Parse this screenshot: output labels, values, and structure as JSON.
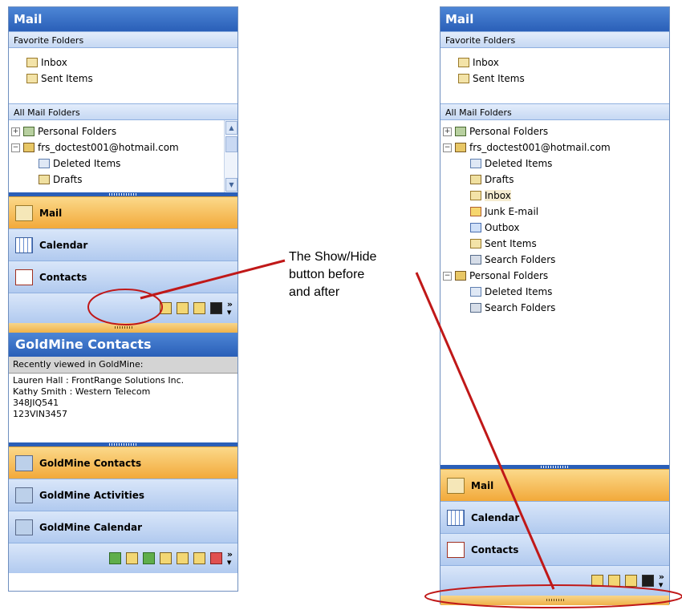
{
  "left": {
    "title": "Mail",
    "favorites_header": "Favorite Folders",
    "favorites": [
      "Inbox",
      "Sent Items"
    ],
    "all_header": "All Mail Folders",
    "tree": [
      {
        "expander": "+",
        "label": "Personal Folders",
        "icon": "personal-folders-icon"
      },
      {
        "expander": "−",
        "label": "frs_doctest001@hotmail.com",
        "icon": "mailbox-icon"
      },
      {
        "label": "Deleted Items",
        "icon": "deleted-items-icon"
      },
      {
        "label": "Drafts",
        "icon": "drafts-icon"
      }
    ],
    "nav": [
      {
        "label": "Mail",
        "icon": "mail-icon",
        "active": true
      },
      {
        "label": "Calendar",
        "icon": "calendar-icon"
      },
      {
        "label": "Contacts",
        "icon": "contacts-icon"
      }
    ],
    "gm_title": "GoldMine Contacts",
    "gm_sub": "Recently viewed in GoldMine:",
    "gm_items": [
      "Lauren Hall : FrontRange Solutions Inc.",
      "Kathy Smith : Western Telecom",
      "348JIQ541",
      "123VIN3457"
    ],
    "gm_nav": [
      {
        "label": "GoldMine Contacts",
        "active": true
      },
      {
        "label": "GoldMine Activities"
      },
      {
        "label": "GoldMine Calendar"
      }
    ]
  },
  "right": {
    "title": "Mail",
    "favorites_header": "Favorite Folders",
    "favorites": [
      "Inbox",
      "Sent Items"
    ],
    "all_header": "All Mail Folders",
    "tree": [
      {
        "label": "Personal Folders"
      },
      {
        "label": "frs_doctest001@hotmail.com"
      },
      {
        "label": "Deleted Items"
      },
      {
        "label": "Drafts"
      },
      {
        "label": "Inbox"
      },
      {
        "label": "Junk E-mail"
      },
      {
        "label": "Outbox"
      },
      {
        "label": "Sent Items"
      },
      {
        "label": "Search Folders"
      },
      {
        "label": "Personal Folders"
      },
      {
        "label": "Deleted Items"
      },
      {
        "label": "Search Folders"
      }
    ],
    "nav": [
      {
        "label": "Mail",
        "active": true
      },
      {
        "label": "Calendar"
      },
      {
        "label": "Contacts"
      }
    ]
  },
  "callout": {
    "line1": "The Show/Hide",
    "line2": "button before",
    "line3": "and after"
  },
  "colors": {
    "accent": "#2a5fb8",
    "annotation": "#c01818",
    "active_nav": "#f2a93a"
  }
}
